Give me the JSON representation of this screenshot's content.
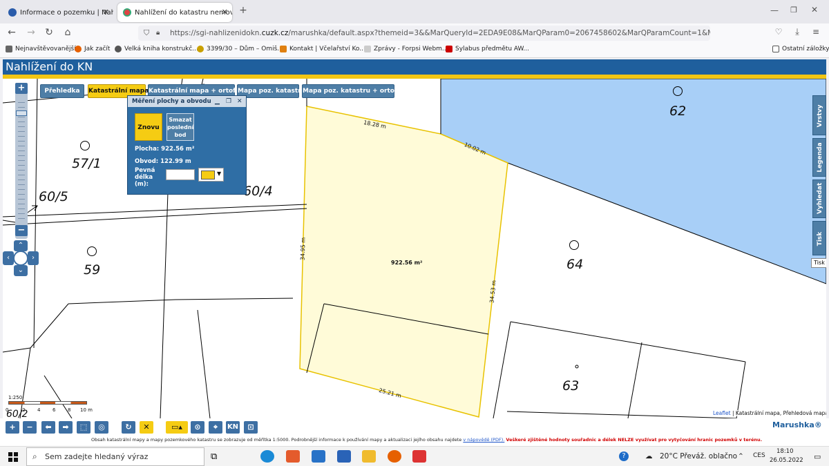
{
  "browser": {
    "tabs": [
      {
        "label": "Informace o pozemku | Nahlíže",
        "active": false
      },
      {
        "label": "Nahlížení do katastru nemovito",
        "active": true
      }
    ],
    "new_tab": "+",
    "url_prefix": "https://sgi-nahlizenidokn.",
    "url_domain": "cuzk.cz",
    "url_rest": "/marushka/default.aspx?themeid=3&&MarQueryId=2EDA9E08&MarQParam0=2067458602&MarQParamCount=1&MarWindowN",
    "bookmarks": [
      "Nejnavštěvovanější",
      "Jak začít",
      "Velká kniha konstrukč...",
      "3399/30 – Dům – Omiš...",
      "Kontakt | Včelařství Ko...",
      "Zprávy - Forpsi Webm...",
      "Sylabus předmětu AW...",
      "Ostatní záložky"
    ]
  },
  "app": {
    "title": "Nahlížení do KN",
    "layers": [
      {
        "label": "Přehledka",
        "active": false
      },
      {
        "label": "Katastrální mapa",
        "active": true
      },
      {
        "label": "Katastrální mapa + ortofoto",
        "active": false
      },
      {
        "label": "Mapa poz. katastru",
        "active": false
      },
      {
        "label": "Mapa poz. katastru + ortofoto",
        "active": false
      }
    ],
    "side_tabs": [
      "Vrstvy",
      "Legenda",
      "Vyhledat",
      "Tisk"
    ],
    "tooltip": "Tisk",
    "zoom_in": "+",
    "zoom_out": "−"
  },
  "map": {
    "parcels": [
      "57/1",
      "60/5",
      "60/4",
      "59",
      "62",
      "64",
      "63",
      "60/2"
    ],
    "area_label": "922.56 m²",
    "segments": [
      "18.28 m",
      "10.02 m",
      "34.95 m",
      "34.53 m",
      "25.21 m"
    ],
    "attribution_link": "Leaflet",
    "attribution_text": "| Katastrální mapa, Přehledová mapa",
    "scale_ratio": "1:250",
    "scale_ticks": [
      "0",
      "2",
      "4",
      "6",
      "8",
      "10 m"
    ]
  },
  "measure_panel": {
    "title": "Měření plochy a obvodu",
    "again_button": "Znovu",
    "delete_last_button": "Smazat poslední bod",
    "area": "Plocha: 922.56 m²",
    "perimeter": "Obvod: 122.99 m",
    "fixed_length_label": "Pevná délka (m):",
    "fixed_length_value": "",
    "color": "#f5cc13"
  },
  "toolbar": {
    "kn_label": "KN",
    "footnote_1": "Obsah katastrální mapy a mapy pozemkového katastru se zobrazuje od měřítka 1:5000. Podrobnější informace k používání mapy a aktualizaci jejího obsahu najdete",
    "footnote_link": "v nápovědě (PDF).",
    "footnote_warning": "Veškeré zjištěné hodnoty souřadnic a délek NELZE využívat pro vytyčování hranic pozemků v terénu.",
    "brand": "Marushka®"
  },
  "taskbar": {
    "search_placeholder": "Sem zadejte hledaný výraz",
    "weather": "20°C  Převáž. oblačno",
    "language": "CES",
    "time": "18:10",
    "date": "26.05.2022"
  }
}
